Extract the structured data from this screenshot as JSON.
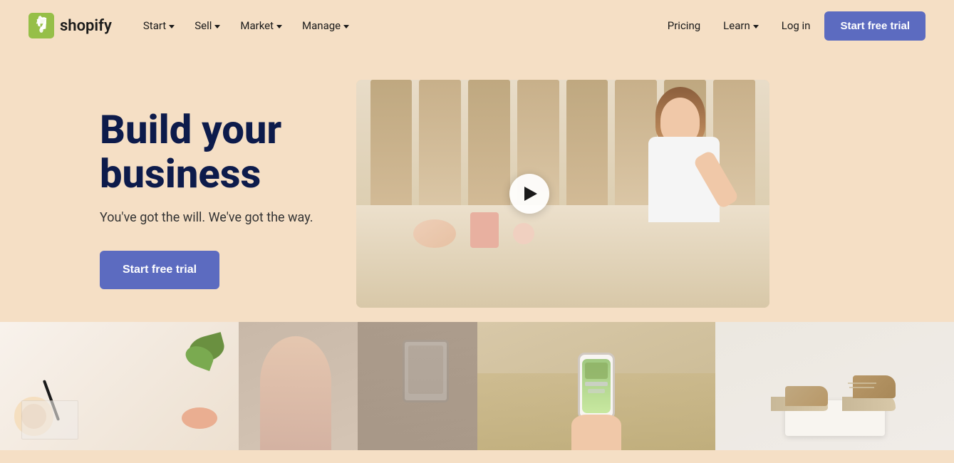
{
  "brand": {
    "name": "shopify",
    "logo_alt": "Shopify"
  },
  "navbar": {
    "logo_label": "shopify",
    "nav_left": [
      {
        "label": "Start",
        "has_dropdown": true,
        "id": "start"
      },
      {
        "label": "Sell",
        "has_dropdown": true,
        "id": "sell"
      },
      {
        "label": "Market",
        "has_dropdown": true,
        "id": "market"
      },
      {
        "label": "Manage",
        "has_dropdown": true,
        "id": "manage"
      }
    ],
    "nav_right": [
      {
        "label": "Pricing",
        "has_dropdown": false,
        "id": "pricing"
      },
      {
        "label": "Learn",
        "has_dropdown": true,
        "id": "learn"
      },
      {
        "label": "Log in",
        "has_dropdown": false,
        "id": "login"
      }
    ],
    "cta_label": "Start free trial"
  },
  "hero": {
    "title_line1": "Build your",
    "title_line2": "business",
    "subtitle": "You've got the will. We've got the way.",
    "cta_label": "Start free trial"
  },
  "video": {
    "play_label": "Play video"
  },
  "thumbnails": [
    {
      "id": "thumb-craft",
      "alt": "Craft workspace"
    },
    {
      "id": "thumb-clothing",
      "alt": "Clothing store"
    },
    {
      "id": "thumb-mobile",
      "alt": "Mobile shopping"
    },
    {
      "id": "thumb-shoes",
      "alt": "Shoe product"
    }
  ]
}
